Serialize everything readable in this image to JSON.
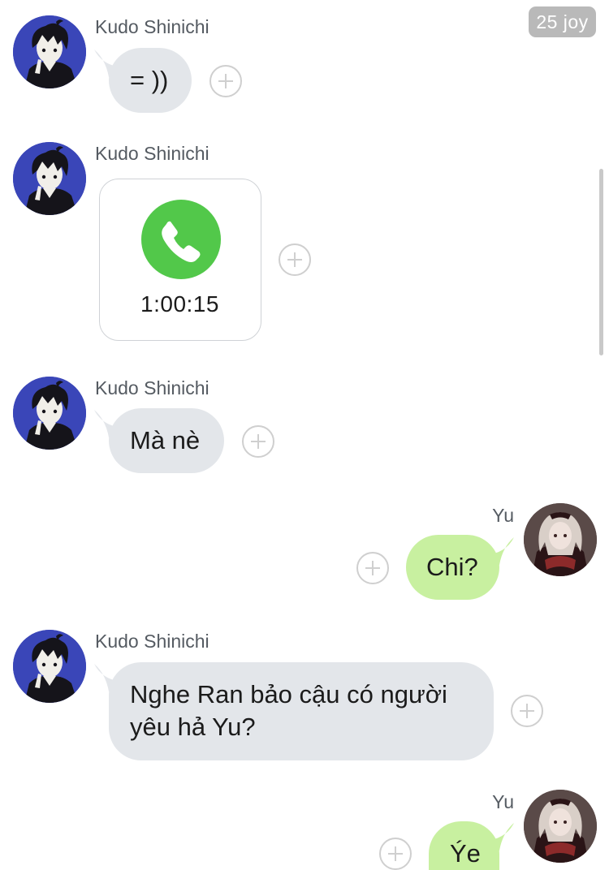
{
  "header": {
    "badge_text": "25 joy"
  },
  "contacts": {
    "incoming_name": "Kudo Shinichi",
    "outgoing_name": "Yu"
  },
  "messages": [
    {
      "sender": "Kudo Shinichi",
      "type": "text",
      "text": "= ))",
      "direction": "incoming"
    },
    {
      "sender": "Kudo Shinichi",
      "type": "call",
      "duration": "1:00:15",
      "direction": "incoming"
    },
    {
      "sender": "Kudo Shinichi",
      "type": "text",
      "text": "Mà nè",
      "direction": "incoming"
    },
    {
      "sender": "Yu",
      "type": "text",
      "text": "Chi?",
      "direction": "outgoing"
    },
    {
      "sender": "Kudo Shinichi",
      "type": "text",
      "lines": [
        "Nghe Ran bảo cậu có người",
        "yêu hả Yu?"
      ],
      "direction": "incoming"
    },
    {
      "sender": "Yu",
      "type": "text",
      "text": "Ýe",
      "direction": "outgoing"
    }
  ],
  "icons": {
    "add_reaction": "plus-circle-icon",
    "call": "phone-icon"
  },
  "colors": {
    "incoming_bubble": "#e3e6ea",
    "outgoing_bubble": "#c8f0a0",
    "call_green": "#52c84a",
    "sender_name": "#555b62",
    "badge_bg": "#b9b9b9",
    "kudo_avatar_bg": "#3a46b8"
  }
}
